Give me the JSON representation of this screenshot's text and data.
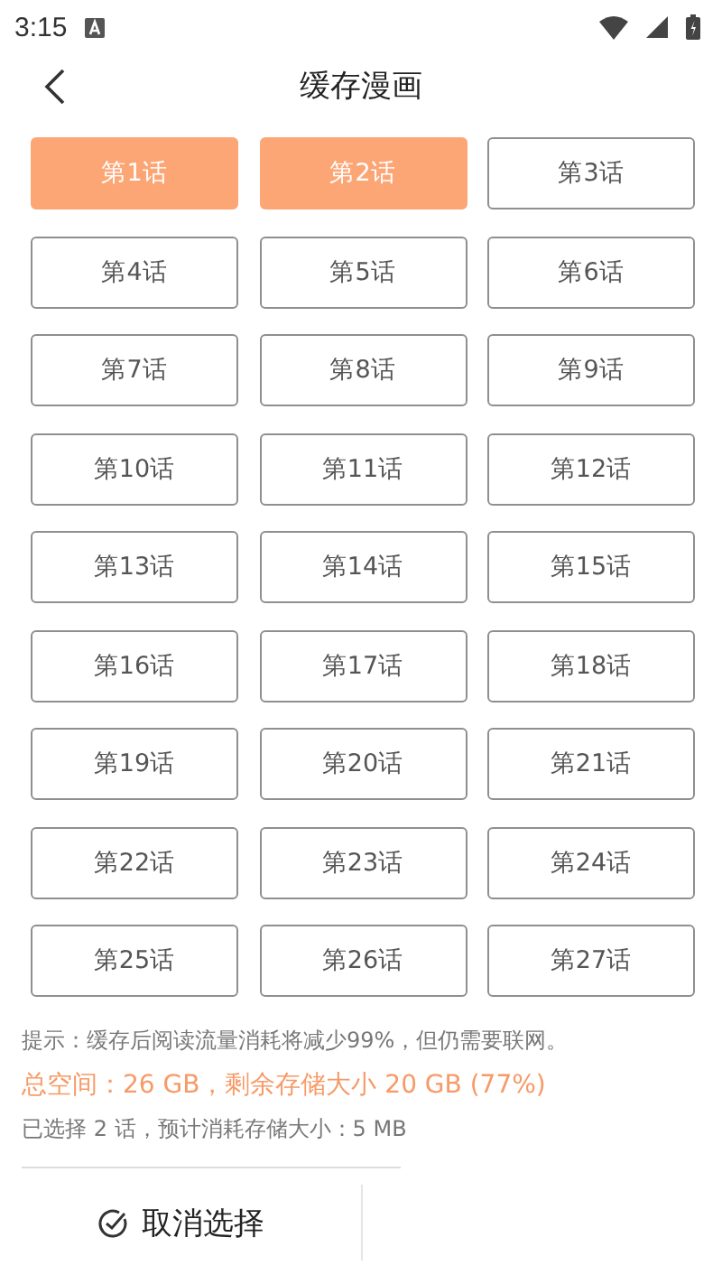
{
  "status_bar": {
    "time": "3:15"
  },
  "header": {
    "title": "缓存漫画"
  },
  "chapters": [
    {
      "label": "第1话",
      "selected": true
    },
    {
      "label": "第2话",
      "selected": true
    },
    {
      "label": "第3话",
      "selected": false
    },
    {
      "label": "第4话",
      "selected": false
    },
    {
      "label": "第5话",
      "selected": false
    },
    {
      "label": "第6话",
      "selected": false
    },
    {
      "label": "第7话",
      "selected": false
    },
    {
      "label": "第8话",
      "selected": false
    },
    {
      "label": "第9话",
      "selected": false
    },
    {
      "label": "第10话",
      "selected": false
    },
    {
      "label": "第11话",
      "selected": false
    },
    {
      "label": "第12话",
      "selected": false
    },
    {
      "label": "第13话",
      "selected": false
    },
    {
      "label": "第14话",
      "selected": false
    },
    {
      "label": "第15话",
      "selected": false
    },
    {
      "label": "第16话",
      "selected": false
    },
    {
      "label": "第17话",
      "selected": false
    },
    {
      "label": "第18话",
      "selected": false
    },
    {
      "label": "第19话",
      "selected": false
    },
    {
      "label": "第20话",
      "selected": false
    },
    {
      "label": "第21话",
      "selected": false
    },
    {
      "label": "第22话",
      "selected": false
    },
    {
      "label": "第23话",
      "selected": false
    },
    {
      "label": "第24话",
      "selected": false
    },
    {
      "label": "第25话",
      "selected": false
    },
    {
      "label": "第26话",
      "selected": false
    },
    {
      "label": "第27话",
      "selected": false
    }
  ],
  "info": {
    "tip": "提示：缓存后阅读流量消耗将减少99%，但仍需要联网。",
    "storage": "总空间：26 GB，剩余存储大小 20 GB (77%)",
    "selection": "已选择 2 话，预计消耗存储大小：5 MB"
  },
  "footer": {
    "cancel_button": "取消选择"
  }
}
